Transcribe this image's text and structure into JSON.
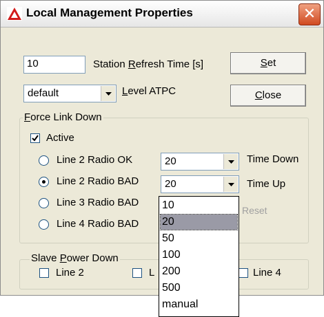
{
  "window": {
    "title": "Local Management Properties",
    "close_glyph": "✕"
  },
  "refresh": {
    "value": "10",
    "label_pre": "Station ",
    "label_acc": "R",
    "label_post": "efresh Time [s]"
  },
  "level": {
    "value": "default",
    "label_pre": "",
    "label_acc": "L",
    "label_post": "evel ATPC"
  },
  "buttons": {
    "set": {
      "acc": "S",
      "rest": "et"
    },
    "close": {
      "acc": "C",
      "rest": "lose"
    },
    "reset": "Reset"
  },
  "force_group": {
    "title_acc": "F",
    "title_rest": "orce Link Down",
    "active_label": "Active",
    "radios": [
      {
        "label": "Line 2 Radio OK",
        "selected": false
      },
      {
        "label": "Line 2 Radio BAD",
        "selected": true
      },
      {
        "label": "Line 3 Radio BAD",
        "selected": false
      },
      {
        "label": "Line 4 Radio BAD",
        "selected": false
      }
    ],
    "time_down": {
      "value": "20",
      "label": "Time Down"
    },
    "time_up": {
      "value": "20",
      "label": "Time Up"
    }
  },
  "slave_group": {
    "title_pre": "Slave ",
    "title_acc": "P",
    "title_rest": "ower Down",
    "line2": "Line 2",
    "line3_partial": "L",
    "line4": "Line 4"
  },
  "dropdown_options": [
    "10",
    "20",
    "50",
    "100",
    "200",
    "500",
    "manual"
  ],
  "dropdown_selected": "20",
  "colors": {
    "accent_close": "#d04a20",
    "selection": "#9a9aa6"
  }
}
